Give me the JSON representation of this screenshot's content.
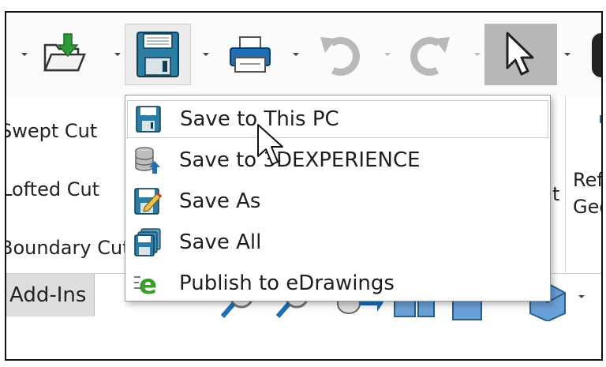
{
  "toolbar": {
    "buttons": [
      "open-folder-icon",
      "save-icon",
      "print-icon",
      "undo-icon",
      "redo-icon",
      "select-pointer-icon"
    ]
  },
  "ribbon": {
    "left_items": [
      "Swept Cut",
      "Lofted Cut",
      "Boundary Cut"
    ],
    "right_fragments": [
      "Ref",
      "Geo",
      "t"
    ]
  },
  "tabs": {
    "addins_label": "Add-Ins"
  },
  "save_menu": {
    "items": [
      {
        "label": "Save to This PC",
        "icon": "floppy-disk-icon"
      },
      {
        "label": "Save to 3DEXPERIENCE",
        "icon": "database-upload-icon"
      },
      {
        "label": "Save As",
        "icon": "save-as-icon"
      },
      {
        "label": "Save All",
        "icon": "save-all-icon"
      },
      {
        "label": "Publish to eDrawings",
        "icon": "edrawings-icon"
      }
    ]
  },
  "colors": {
    "accent_blue": "#1e6fb8",
    "save_teal": "#2b7da3",
    "edrawings_green": "#3a9d2a",
    "folder_yellow": "#e7c34a"
  }
}
